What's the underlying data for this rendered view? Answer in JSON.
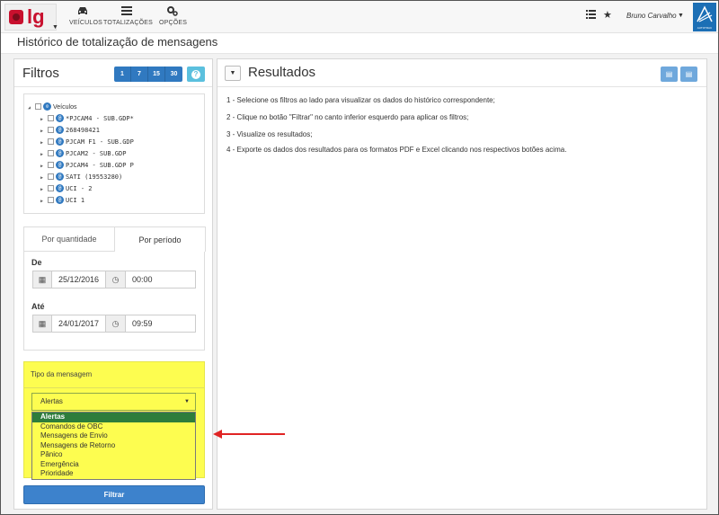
{
  "app": {
    "logo_text": "lg",
    "nav": [
      {
        "label": "VEÍCULOS",
        "icon": "car-icon"
      },
      {
        "label": "TOTALIZAÇÕES",
        "icon": "list-icon"
      },
      {
        "label": "OPÇÕES",
        "icon": "gears-icon"
      }
    ],
    "user_name": "Bruno Carvalho",
    "brand_label": "AUTOTRAC"
  },
  "page": {
    "title": "Histórico de totalização de mensagens"
  },
  "filters": {
    "title": "Filtros",
    "ranges": [
      "1",
      "7",
      "15",
      "30"
    ],
    "help_icon": "?",
    "tree": {
      "root": "Veículos",
      "items": [
        "*PJCAM4 - SUB.GDP*",
        "268498421",
        "PJCAM F1 - SUB.GDP",
        "PJCAM2 - SUB.GDP",
        "PJCAM4 - SUB.GDP P",
        "SATI (19553280)",
        "UCI - 2",
        "UCI 1"
      ]
    },
    "tabs": {
      "quantity": "Por quantidade",
      "period": "Por período"
    },
    "from_label": "De",
    "from_date": "25/12/2016",
    "from_time": "00:00",
    "to_label": "Até",
    "to_date": "24/01/2017",
    "to_time": "09:59",
    "message_type_label": "Tipo da mensagem",
    "message_type_selected": "Alertas",
    "message_type_options": [
      "Alertas",
      "Comandos de OBC",
      "Mensagens de Envio",
      "Mensagens de Retorno",
      "Pânico",
      "Emergência",
      "Prioridade"
    ],
    "filter_button": "Filtrar"
  },
  "results": {
    "title": "Resultados",
    "instructions": [
      "1 - Selecione os filtros ao lado para visualizar os dados do histórico correspondente;",
      "2 - Clique no botão \"Filtrar\" no canto inferior esquerdo para aplicar os filtros;",
      "3 - Visualize os resultados;",
      "4 - Exporte os dados dos resultados para os formatos PDF e Excel clicando nos respectivos botões acima."
    ]
  },
  "colors": {
    "primary": "#3079c0",
    "highlight": "#fdfd50",
    "selected_option": "#2e7d3b",
    "arrow": "#e02424",
    "brand": "#c8102e"
  }
}
